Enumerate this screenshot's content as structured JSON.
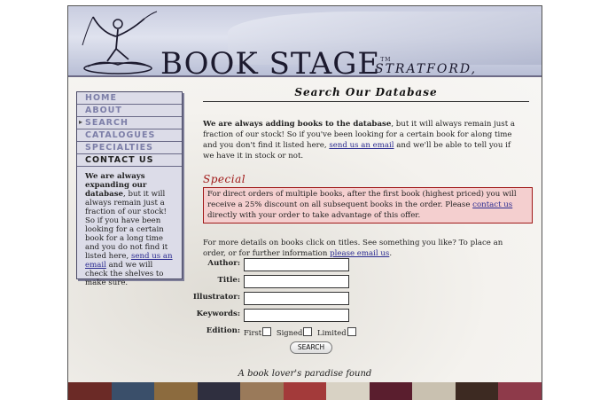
{
  "header": {
    "brand": "BOOK STAGE",
    "brand_tm": "TM",
    "location": "STRATFORD, ONTARIO"
  },
  "nav": {
    "items": [
      {
        "label": "HOME"
      },
      {
        "label": "ABOUT"
      },
      {
        "label": "SEARCH"
      },
      {
        "label": "CATALOGUES"
      },
      {
        "label": "SPECIALTIES"
      },
      {
        "label": "CONTACT US"
      }
    ]
  },
  "sidebar": {
    "bold": "We are always expanding our database",
    "text1": ", but it will always remain just a fraction of our stock! So if you have been looking for a certain book for a long time and you do not find it listed here, ",
    "link": "send us an email",
    "text2": " and we will check the shelves to make sure."
  },
  "main": {
    "title": "Search Our Database",
    "intro_bold": "We are always adding books to the database",
    "intro_text1": ", but it will always remain just a fraction of our stock! So if you've been looking for a certain book for along time and you don't find it listed here, ",
    "intro_link": "send us an email",
    "intro_text2": " and we'll be able to tell you if we have it in stock or not.",
    "special_heading": "Special",
    "special_text1": "For direct orders of multiple books, after the first book (highest priced) you will receive a 25% discount on all subsequent books in the order. Please ",
    "special_link": "contact us",
    "special_text2": " directly with your order to take advantage of this offer.",
    "more_text": "For more details on books click on titles. See something you like? To place an order, or for further information ",
    "more_link": "please email us",
    "more_end": "."
  },
  "form": {
    "author_label": "Author:",
    "title_label": "Title:",
    "illustrator_label": "Illustrator:",
    "keywords_label": "Keywords:",
    "edition_label": "Edition:",
    "edition_options": [
      "First",
      "Signed",
      "Limited"
    ],
    "search_button": "SEARCH"
  },
  "footer": {
    "tagline": "A book lover's paradise found"
  },
  "colors": {
    "nav_text": "#7d7fa8",
    "special_red": "#a01818",
    "special_bg": "#f4cfcf",
    "link": "#2a2a90"
  }
}
